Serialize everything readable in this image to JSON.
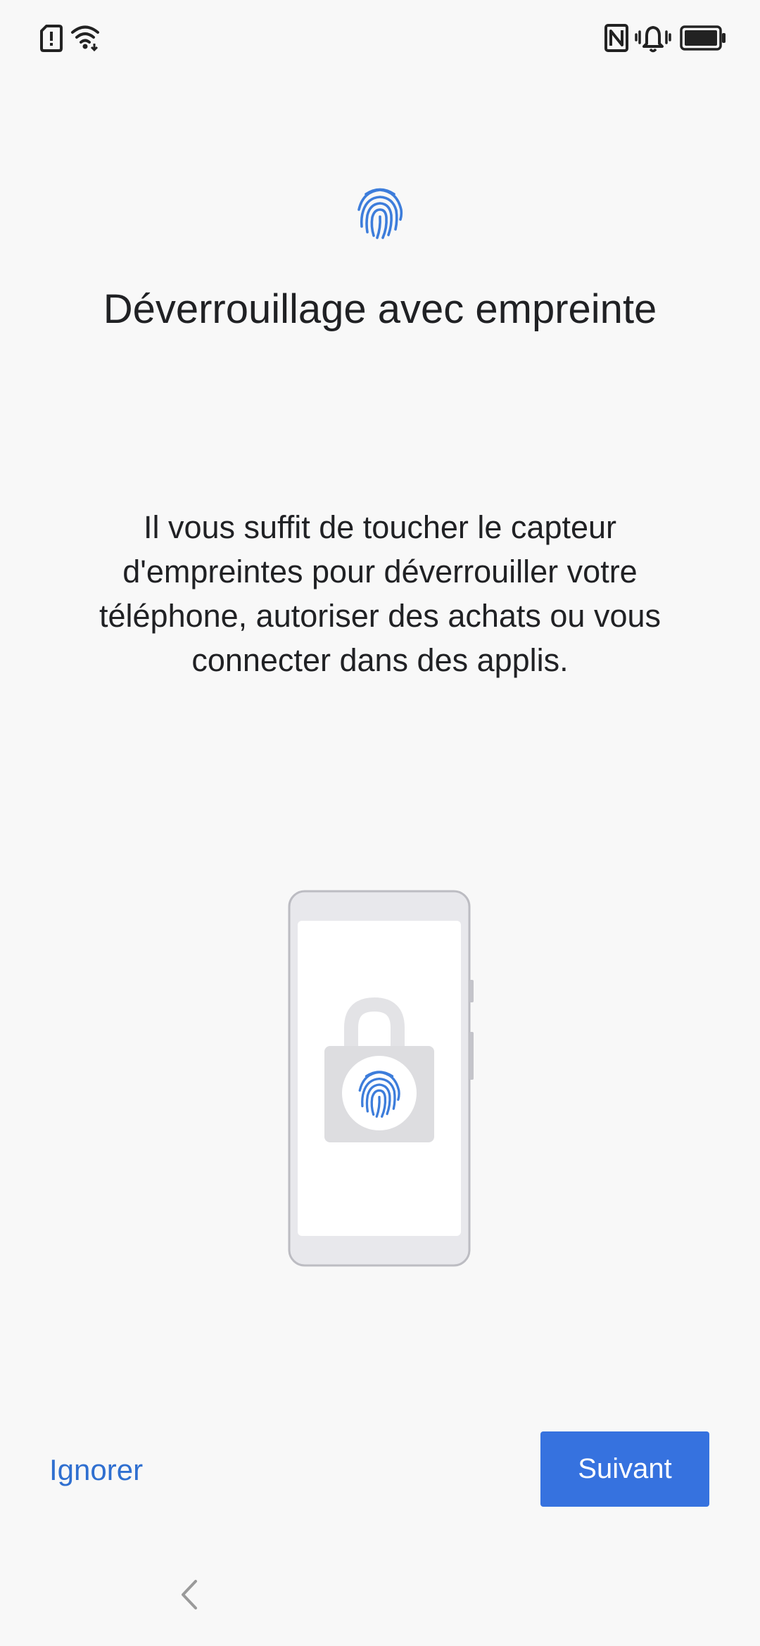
{
  "status_bar": {
    "left_icons": [
      "sim-alert-icon",
      "wifi-icon"
    ],
    "right_icons": [
      "nfc-icon",
      "vibrate-icon",
      "battery-icon"
    ]
  },
  "header": {
    "icon": "fingerprint-icon",
    "title": "Déverrouillage avec empreinte"
  },
  "body": {
    "description": "Il vous suffit de toucher le capteur d'empreintes pour déverrouiller votre téléphone, autoriser des achats ou vous connecter dans des applis."
  },
  "illustration": {
    "icons": [
      "phone-icon",
      "unlocked-padlock-icon",
      "fingerprint-icon"
    ]
  },
  "footer": {
    "skip_label": "Ignorer",
    "next_label": "Suivant"
  },
  "navigation": {
    "back_icon": "back-chevron-icon"
  },
  "colors": {
    "accent": "#3672df",
    "link": "#2f6fd0",
    "fingerprint": "#3d7ddb",
    "background": "#f8f8f8"
  }
}
